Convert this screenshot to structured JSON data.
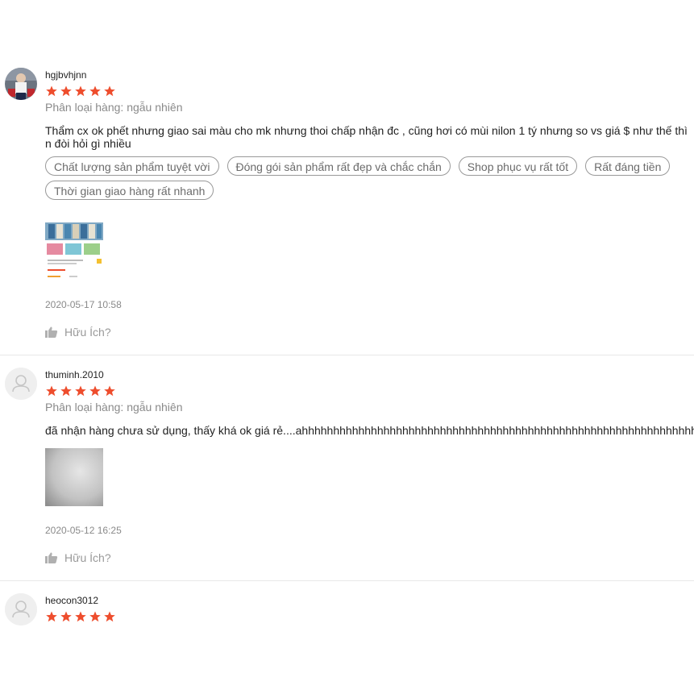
{
  "reviews": [
    {
      "username": "hgjbvhjnn",
      "rating": 5,
      "variation": "Phân loại hàng: ngẫu nhiên",
      "content": "Thẩm cx ok phết nhưng giao sai màu cho mk nhưng thoi chấp nhận đc , cũng hơi có mùi nilon 1 tý nhưng so vs giá $ như thế thì n đòi hỏi gì nhiều",
      "tags": [
        "Chất lượng sản phẩm tuyệt vời",
        "Đóng gói sản phẩm rất đẹp và chắc chắn",
        "Shop phục vụ rất tốt",
        "Rất đáng tiền",
        "Thời gian giao hàng rất nhanh"
      ],
      "date": "2020-05-17 10:58",
      "helpful_label": "Hữu Ích?"
    },
    {
      "username": "thuminh.2010",
      "rating": 5,
      "variation": "Phân loại hàng: ngẫu nhiên",
      "content": "đã nhận hàng chưa sử dụng, thấy khá ok giá rẻ....ahhhhhhhhhhhhhhhhhhhhhhhhhhhhhhhhhhhhhhhhhhhhhhhhhhhhhhhhhhhhhhhhhhhbb",
      "tags": [],
      "date": "2020-05-12 16:25",
      "helpful_label": "Hữu Ích?"
    },
    {
      "username": "heocon3012",
      "rating": 5
    }
  ],
  "colors": {
    "star": "#ee4d2d",
    "muted_text": "#8a8a8a",
    "divider": "#e8e8e8"
  },
  "icons": {
    "star": "star-icon",
    "helpful": "thumbs-up-icon",
    "default_avatar": "user-silhouette-icon"
  }
}
